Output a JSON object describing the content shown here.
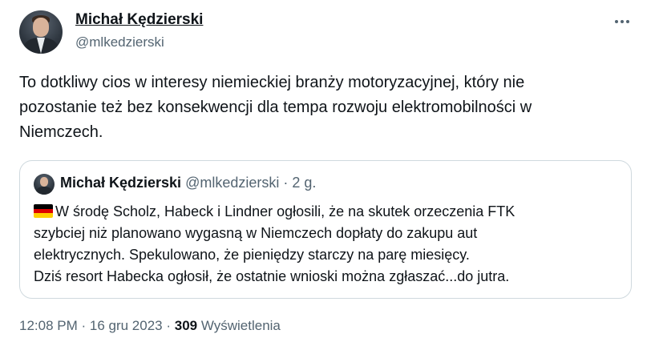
{
  "author": {
    "name": "Michał Kędzierski",
    "handle": "@mlkedzierski"
  },
  "tweet": {
    "text": "To dotkliwy cios w interesy niemieckiej branży motoryzacyjnej, który nie\npozostanie też bez konsekwencji dla tempa rozwoju elektromobilności w\nNiemczech."
  },
  "quoted": {
    "name": "Michał Kędzierski",
    "handle": "@mlkedzierski",
    "separator": " · ",
    "time": "2 g.",
    "text": "W środę Scholz, Habeck i Lindner ogłosili, że na skutek orzeczenia FTK\nszybciej niż planowano wygasną w Niemczech dopłaty do zakupu aut\nelektrycznych. Spekulowano, że pieniędzy starczy na parę miesięcy.\nDziś resort Habecka ogłosił, że ostatnie wnioski można zgłaszać...do jutra.",
    "flag_icon": "germany-flag-icon",
    "flag_colors": [
      "#000000",
      "#dd0000",
      "#ffce00"
    ]
  },
  "meta": {
    "time": "12:08 PM",
    "separator": " · ",
    "date": "16 gru 2023",
    "views_count": "309",
    "views_label": "Wyświetlenia"
  },
  "icons": {
    "more": "more-dots-icon"
  }
}
